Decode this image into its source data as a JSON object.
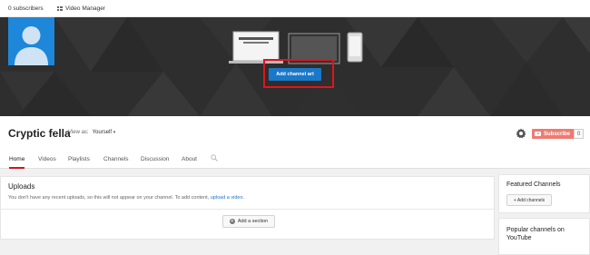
{
  "topbar": {
    "subscribers": "0 subscribers",
    "video_manager": "Video Manager",
    "video_manager_icon": "video-manager-icon"
  },
  "banner": {
    "add_channel_art": "Add channel art",
    "accent": "#1a78c9",
    "highlight_color": "#e3131b"
  },
  "channel": {
    "name": "Cryptic fella",
    "view_as_label": "View as:",
    "view_as_value": "Yourself",
    "subscribe_label": "Subscribe",
    "subscriber_count": "0"
  },
  "tabs": [
    {
      "label": "Home",
      "active": true
    },
    {
      "label": "Videos"
    },
    {
      "label": "Playlists"
    },
    {
      "label": "Channels"
    },
    {
      "label": "Discussion"
    },
    {
      "label": "About"
    }
  ],
  "uploads": {
    "title": "Uploads",
    "message": "You don't have any recent uploads, so this will not appear on your channel. To add content,",
    "link": "upload a video",
    "period": ".",
    "add_section": "Add a section"
  },
  "sidebar": {
    "featured_title": "Featured Channels",
    "add_channels": "+ Add channels",
    "popular_title": "Popular channels on YouTube"
  }
}
